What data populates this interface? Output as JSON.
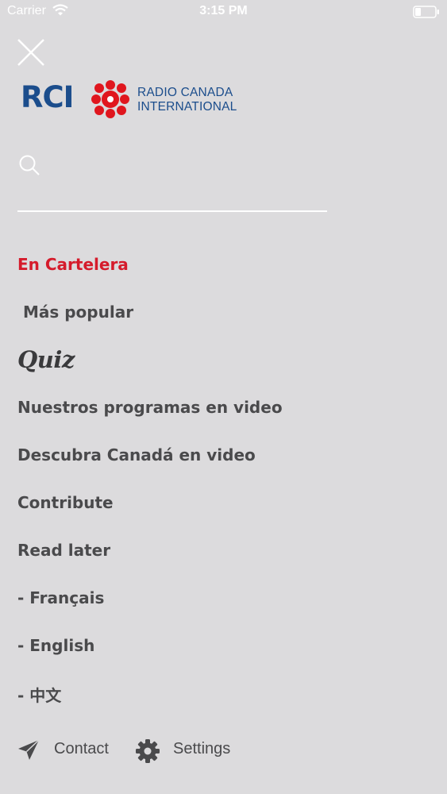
{
  "status_bar": {
    "carrier": "Carrier",
    "time": "3:15 PM"
  },
  "header": {
    "close_icon": "close-icon",
    "logo": {
      "abbr": "RCI",
      "line1": "RADIO CANADA",
      "line2": "INTERNATIONAL",
      "brand_blue": "#1b4d8c",
      "brand_red": "#e0161e"
    }
  },
  "search": {
    "icon": "search-icon",
    "placeholder": "",
    "value": ""
  },
  "menu": {
    "active_color": "#d51b2b",
    "items": [
      {
        "label": "En Cartelera",
        "active": true
      },
      {
        "label": " Más popular",
        "active": false
      },
      {
        "label": "Quiz",
        "active": false
      },
      {
        "label": "Nuestros programas en video",
        "active": false
      },
      {
        "label": "Descubra Canadá en video",
        "active": false
      },
      {
        "label": "Contribute",
        "active": false
      },
      {
        "label": "Read later",
        "active": false
      },
      {
        "label": "- Français",
        "active": false
      },
      {
        "label": "- English",
        "active": false
      },
      {
        "label": "- 中文",
        "active": false
      }
    ]
  },
  "footer": {
    "contact": {
      "label": "Contact",
      "icon": "send-icon"
    },
    "settings": {
      "label": "Settings",
      "icon": "gear-icon"
    }
  }
}
